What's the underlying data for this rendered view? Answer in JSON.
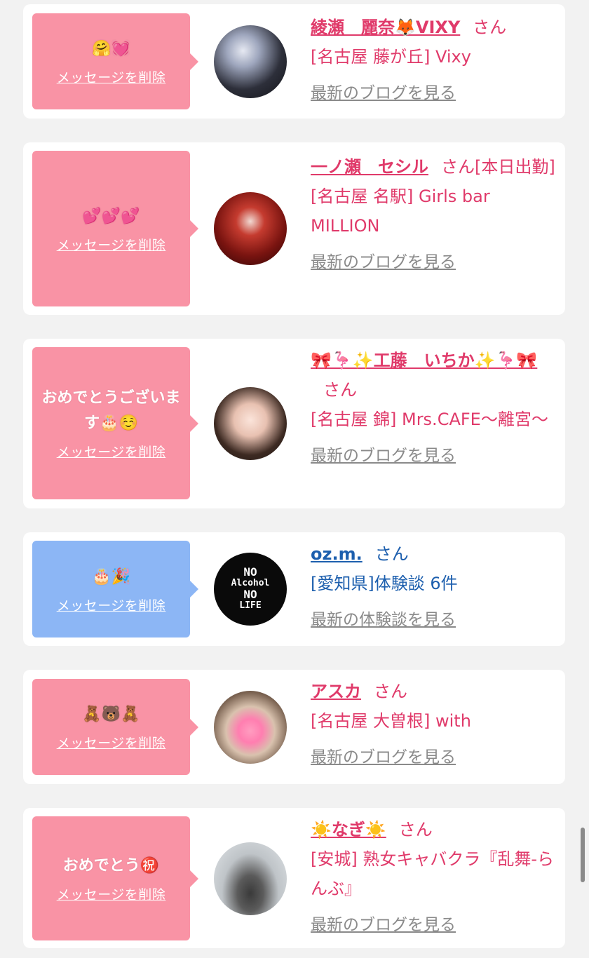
{
  "delete_label": "メッセージを削除",
  "san": "さん",
  "items": [
    {
      "message": "🤗💓",
      "name": "綾瀬　麗奈🦊VIXY",
      "name_suffix": "",
      "shop": "[名古屋 藤が丘] Vixy",
      "blog": "最新のブログを見る",
      "theme": "pink"
    },
    {
      "message": "💕💕💕",
      "name": "一ノ瀬　セシル",
      "name_suffix": "[本日出勤]",
      "shop": "[名古屋 名駅] Girls bar MILLION",
      "blog": "最新のブログを見る",
      "theme": "pink"
    },
    {
      "message": "おめでとうございます🎂☺️",
      "name": "🎀🦩✨工藤　いちか✨🦩🎀",
      "name_suffix": "",
      "shop": "[名古屋 錦] Mrs.CAFE〜離宮〜",
      "blog": "最新のブログを見る",
      "theme": "pink"
    },
    {
      "message": "🎂🎉",
      "name": "oz.m.",
      "name_suffix": "",
      "shop": "[愛知県]体験談 6件",
      "blog": "最新の体験談を見る",
      "theme": "blue",
      "avatar_text": [
        "NO",
        "Alcohol",
        "NO",
        "LIFE"
      ]
    },
    {
      "message": "🧸🐻🧸",
      "name": "アスカ",
      "name_suffix": "",
      "shop": "[名古屋 大曽根] with",
      "blog": "最新のブログを見る",
      "theme": "pink"
    },
    {
      "message": "おめでとう㊗️",
      "name": "☀️なぎ☀️",
      "name_suffix": "",
      "shop": "[安城] 熟女キャバクラ『乱舞-らんぶ』",
      "blog": "最新のブログを見る",
      "theme": "pink"
    }
  ],
  "colors": {
    "pink_bubble": "#f993a5",
    "blue_bubble": "#8cb6f5",
    "pink_text": "#e03a6a",
    "blue_text": "#1d5fae",
    "link_gray": "#8a8a8a"
  }
}
